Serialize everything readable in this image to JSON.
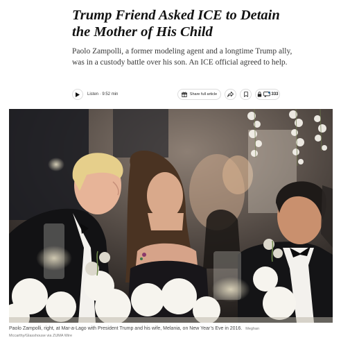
{
  "article": {
    "headline": "Trump Friend Asked ICE to Detain the Mother of His Child",
    "summary": "Paolo Zampolli, a former modeling agent and a longtime Trump ally, was in a custody battle over his son. An ICE official agreed to help."
  },
  "toolbar": {
    "listen_label": "Listen · 9:52 min",
    "share_full_label": "Share full article",
    "comment_count": "333",
    "icons": [
      "play-icon",
      "gift-icon",
      "share-icon",
      "bookmark-icon",
      "comment-icon"
    ]
  },
  "photo": {
    "caption": "Paolo Zampolli, right, at Mar-a-Lago with President Trump and his wife, Melania, on New Year’s Eve in 2016.",
    "credit": "Meghan Mccarthy/Glasshouse via ZUMA Wire"
  }
}
